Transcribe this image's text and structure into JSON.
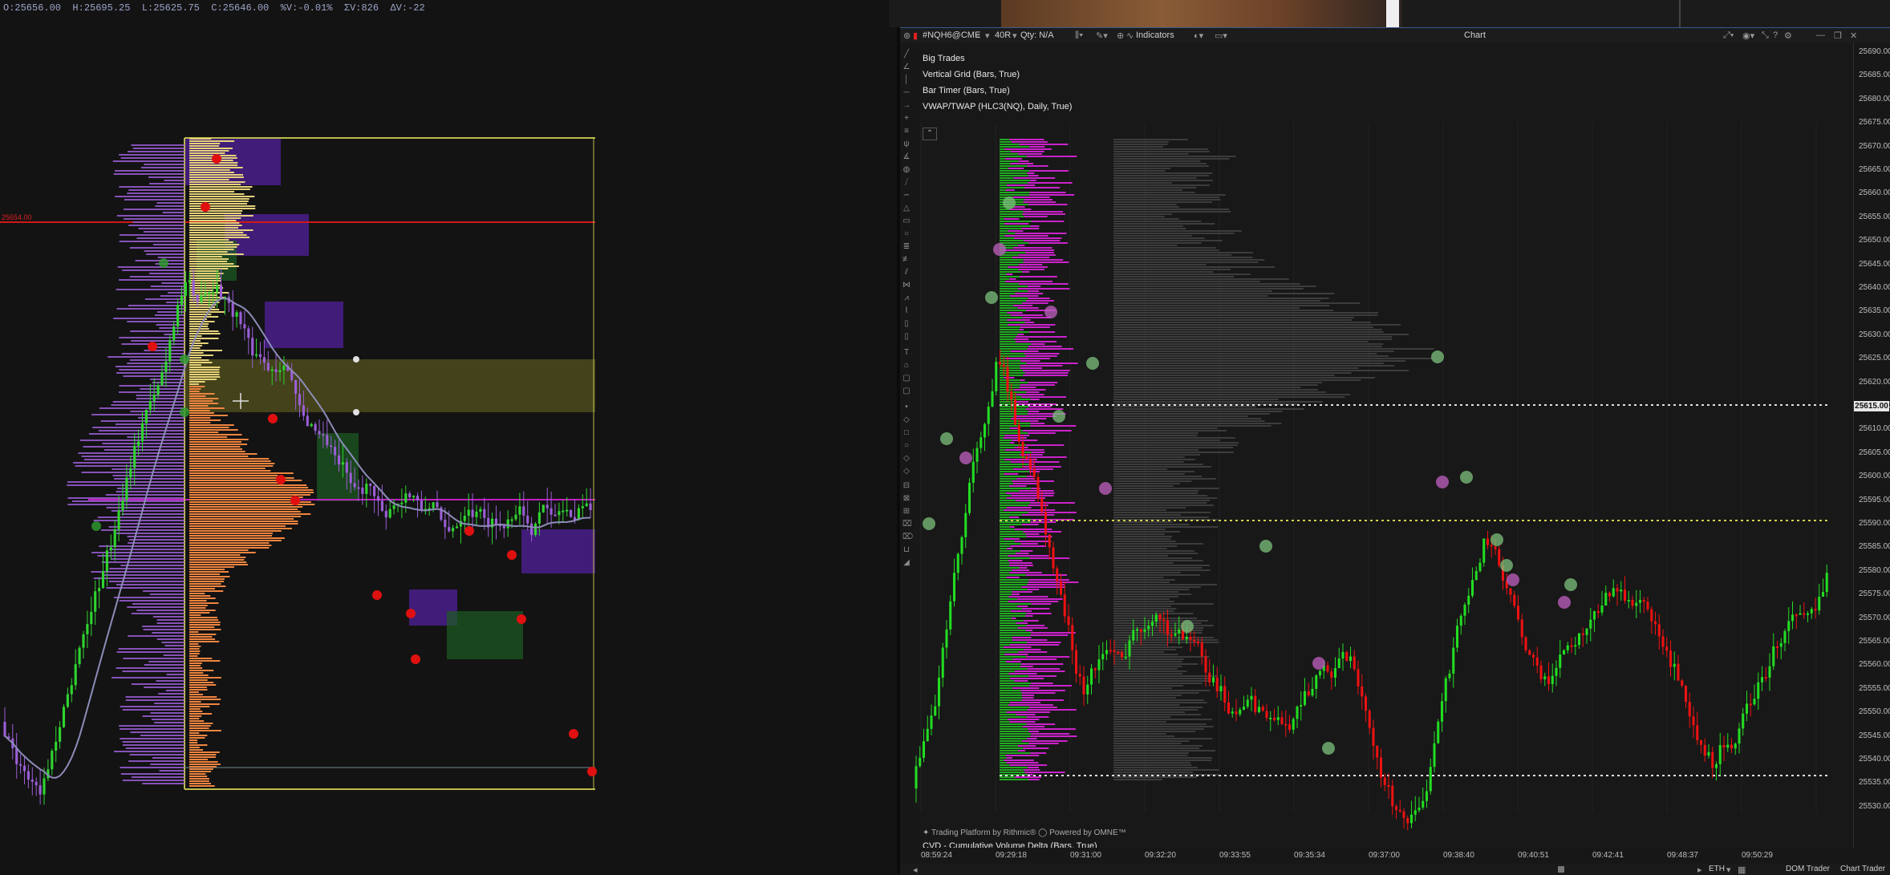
{
  "left_chart": {
    "ohlc_text": "O:25656.00  H:25695.25  L:25625.75  C:25646.00  %V:-0.01%  ΣV:826  ΔV:-22",
    "hline_label": "25654.00",
    "colors": {
      "up_candle": "#2fd42f",
      "down_candle": "#e02020",
      "delta_bar": "#9b5ed6",
      "volume_profile_upper": "#e6d27a",
      "volume_profile_lower": "#f08540",
      "vwap_line": "#8c8cb8",
      "hline_red": "#d01818",
      "hline_magenta": "#c020c0",
      "zone_purple": "#4a1f8c",
      "zone_yellow": "#6b6a20",
      "zone_green": "#1c5c22"
    }
  },
  "toolbar": {
    "symbol": "#NQH6@CME",
    "search_icon": "search-icon",
    "bar_type": "40R",
    "qty": "Qty: N/A",
    "indicators_label": "Indicators",
    "title": "Chart",
    "window_buttons": [
      "minimize-icon",
      "restore-icon",
      "close-icon"
    ]
  },
  "indicators": [
    "Big Trades",
    "Vertical Grid (Bars, True)",
    "Bar Timer (Bars, True)",
    "VWAP/TWAP (HLC3(NQ), Daily, True)"
  ],
  "price_axis": {
    "labels": [
      "25690.00",
      "25685.00",
      "25680.00",
      "25675.00",
      "25670.00",
      "25665.00",
      "25660.00",
      "25655.00",
      "25650.00",
      "25645.00",
      "25640.00",
      "25635.00",
      "25630.00",
      "25625.00",
      "25620.00",
      "25615.00",
      "25610.00",
      "25605.00",
      "25600.00",
      "25595.00",
      "25590.00",
      "25585.00",
      "25580.00",
      "25575.00",
      "25570.00",
      "25565.00",
      "25560.00",
      "25555.00",
      "25550.00",
      "25545.00",
      "25540.00",
      "25535.00",
      "25530.00"
    ],
    "current_price": "25615.00"
  },
  "time_axis": {
    "labels": [
      "08:59:24",
      "09:29:18",
      "09:31:00",
      "09:32:20",
      "09:33:55",
      "09:35:34",
      "09:37:00",
      "09:38:40",
      "09:40:51",
      "09:42:41",
      "09:48:37",
      "09:50:29"
    ]
  },
  "watermark": "✦ Trading Platform by Rithmic®  ◯ Powered by OMNE™",
  "cvd_title": "CVD - Cumulative Volume Delta (Bars, True)",
  "statusbar": {
    "session": "ETH",
    "dom_trader": "DOM Trader",
    "chart_trader": "Chart Trader"
  },
  "right_chart": {
    "colors": {
      "up_candle": "#22dd22",
      "down_candle": "#ee1111",
      "profile_buy": "#22aa22",
      "profile_sell": "#cc22cc",
      "profile_gray": "#555555",
      "big_trade_buy": "#7cc07c",
      "big_trade_sell": "#c060c0"
    }
  }
}
